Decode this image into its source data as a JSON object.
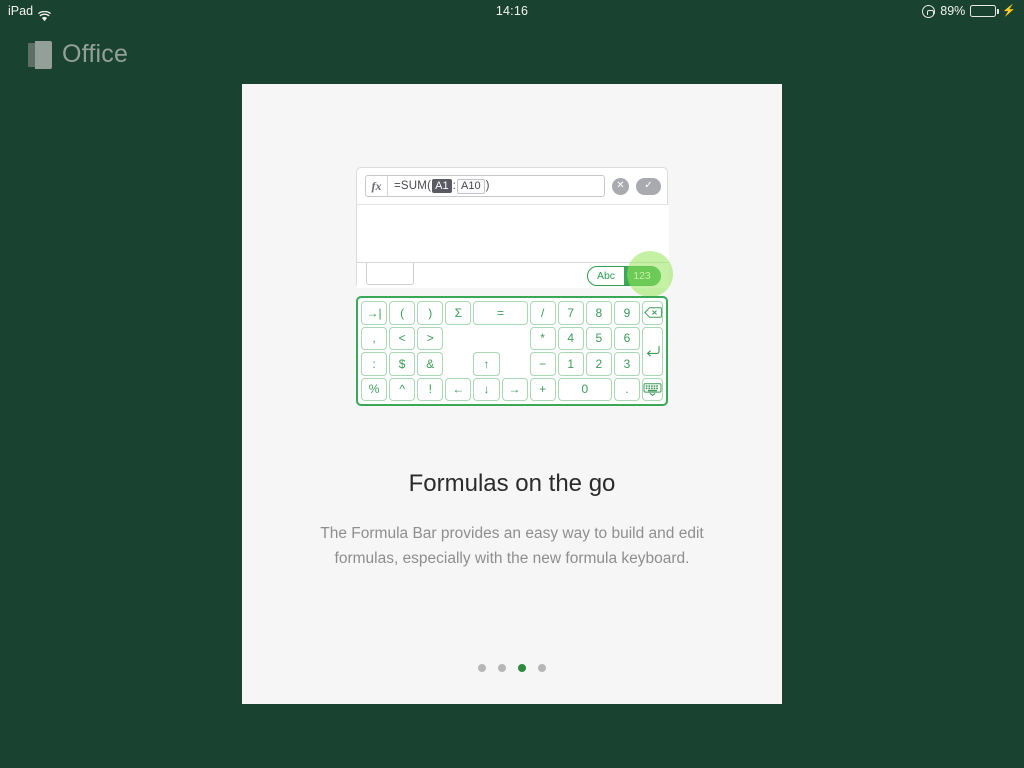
{
  "statusbar": {
    "device_label": "iPad",
    "wifi_icon": "wifi-icon",
    "time": "14:16",
    "rotation_lock_icon": "rotation-lock-icon",
    "battery_percent": "89%",
    "battery_level": 89,
    "battery_icon": "battery-icon",
    "charging_icon": "lightning-bolt-icon"
  },
  "brand": {
    "logo_icon": "office-logo-icon",
    "name": "Office"
  },
  "mock_app": {
    "formula_bar": {
      "fx_label": "fx",
      "formula_prefix": "=SUM(",
      "ref_selected": "A1",
      "ref_separator": ":",
      "ref_second": "A10",
      "formula_suffix": ")",
      "cancel_icon": "cancel-x-icon",
      "confirm_icon": "confirm-check-icon"
    },
    "sheet_tab_label": "",
    "keyboard_toggle": {
      "alpha_label": "Abc",
      "numeric_label": "123",
      "selected": "123"
    }
  },
  "keyboard": {
    "keys": [
      {
        "name": "key-tab",
        "glyph": "→|",
        "col": 1,
        "span": 2,
        "row": 1
      },
      {
        "name": "key-open-paren",
        "glyph": "(",
        "col": 3,
        "span": 2,
        "row": 1
      },
      {
        "name": "key-close-paren",
        "glyph": ")",
        "col": 5,
        "span": 2,
        "row": 1
      },
      {
        "name": "key-sigma",
        "glyph": "Σ",
        "col": 7,
        "span": 2,
        "row": 1
      },
      {
        "name": "key-equals",
        "glyph": "=",
        "col": 9,
        "span": 4,
        "row": 1
      },
      {
        "name": "key-divide",
        "glyph": "/",
        "col": 13,
        "span": 2,
        "row": 1
      },
      {
        "name": "key-7",
        "glyph": "7",
        "col": 15,
        "span": 2,
        "row": 1
      },
      {
        "name": "key-8",
        "glyph": "8",
        "col": 17,
        "span": 2,
        "row": 1
      },
      {
        "name": "key-9",
        "glyph": "9",
        "col": 19,
        "span": 2,
        "row": 1
      },
      {
        "name": "key-comma",
        "glyph": ",",
        "col": 1,
        "span": 2,
        "row": 2
      },
      {
        "name": "key-less-than",
        "glyph": "<",
        "col": 3,
        "span": 2,
        "row": 2
      },
      {
        "name": "key-greater-than",
        "glyph": ">",
        "col": 5,
        "span": 2,
        "row": 2
      },
      {
        "name": "key-multiply",
        "glyph": "*",
        "col": 13,
        "span": 2,
        "row": 2
      },
      {
        "name": "key-4",
        "glyph": "4",
        "col": 15,
        "span": 2,
        "row": 2
      },
      {
        "name": "key-5",
        "glyph": "5",
        "col": 17,
        "span": 2,
        "row": 2
      },
      {
        "name": "key-6",
        "glyph": "6",
        "col": 19,
        "span": 2,
        "row": 2
      },
      {
        "name": "key-colon",
        "glyph": ":",
        "col": 1,
        "span": 2,
        "row": 3
      },
      {
        "name": "key-dollar",
        "glyph": "$",
        "col": 3,
        "span": 2,
        "row": 3
      },
      {
        "name": "key-ampersand",
        "glyph": "&",
        "col": 5,
        "span": 2,
        "row": 3
      },
      {
        "name": "key-arrow-up",
        "glyph": "↑",
        "col": 9,
        "span": 2,
        "row": 3
      },
      {
        "name": "key-minus",
        "glyph": "−",
        "col": 13,
        "span": 2,
        "row": 3
      },
      {
        "name": "key-1",
        "glyph": "1",
        "col": 15,
        "span": 2,
        "row": 3
      },
      {
        "name": "key-2",
        "glyph": "2",
        "col": 17,
        "span": 2,
        "row": 3
      },
      {
        "name": "key-3",
        "glyph": "3",
        "col": 19,
        "span": 2,
        "row": 3
      },
      {
        "name": "key-percent",
        "glyph": "%",
        "col": 1,
        "span": 2,
        "row": 4
      },
      {
        "name": "key-caret",
        "glyph": "^",
        "col": 3,
        "span": 2,
        "row": 4
      },
      {
        "name": "key-exclamation",
        "glyph": "!",
        "col": 5,
        "span": 2,
        "row": 4
      },
      {
        "name": "key-arrow-left",
        "glyph": "←",
        "col": 7,
        "span": 2,
        "row": 4
      },
      {
        "name": "key-arrow-down",
        "glyph": "↓",
        "col": 9,
        "span": 2,
        "row": 4
      },
      {
        "name": "key-arrow-right",
        "glyph": "→",
        "col": 11,
        "span": 2,
        "row": 4
      },
      {
        "name": "key-plus",
        "glyph": "+",
        "col": 13,
        "span": 2,
        "row": 4
      },
      {
        "name": "key-0",
        "glyph": "0",
        "col": 15,
        "span": 4,
        "row": 4
      },
      {
        "name": "key-period",
        "glyph": ".",
        "col": 19,
        "span": 2,
        "row": 4
      }
    ],
    "backspace_icon": "backspace-icon",
    "enter_icon": "enter-return-icon",
    "dismiss_keyboard_icon": "hide-keyboard-icon"
  },
  "content": {
    "title": "Formulas on the go",
    "subtitle": "The Formula Bar provides an easy way to build and edit formulas, especially with the new formula keyboard."
  },
  "pager": {
    "total": 4,
    "active_index": 3
  },
  "colors": {
    "background_green": "#1a4230",
    "card": "#f6f6f6",
    "accent_green": "#3aa856",
    "key_border": "#a8d8b4",
    "key_text": "#3d9b5a",
    "active_dot": "#2b8a3e",
    "title_text": "#2b2b2b",
    "subtitle_text": "#8e8e8e",
    "brand_text": "#93a09a",
    "battery_fill": "#4cd964"
  }
}
